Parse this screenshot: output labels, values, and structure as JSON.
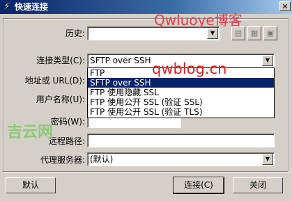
{
  "window": {
    "title": "快速连接",
    "close_glyph": "✕",
    "icon": "lightning-icon"
  },
  "form": {
    "history_label": "历史:",
    "history_value": "",
    "conn_type_label": "连接类型(C):",
    "conn_type_value": "SFTP over SSH",
    "address_label": "地址或 URL(D):",
    "username_label": "用户名称(U):",
    "password_label": "密码(W):",
    "password_value": "",
    "remote_path_label": "远程路径:",
    "remote_path_value": "",
    "proxy_label": "代理服务器:",
    "proxy_value": "(默认)"
  },
  "dropdown": {
    "options": [
      "FTP",
      "SFTP over SSH",
      "FTP 使用隐藏 SSL",
      "FTP 使用公开 SSL (验证 SSL)",
      "FTP 使用公开 SSL (验证 TLS)"
    ],
    "selected_index": 1
  },
  "toolbar": {
    "icons": [
      "history-save-icon",
      "history-edit-icon",
      "history-delete-icon"
    ],
    "glyphs": [
      "▤",
      "▦",
      "▣"
    ]
  },
  "buttons": {
    "default_label": "默认",
    "connect_label": "连接(C)",
    "close_label": "关闭"
  },
  "watermarks": {
    "blog_name": "Qwluoye博客",
    "blog_url": "qwblog.cn",
    "site_logo": "吉云网"
  },
  "colors": {
    "selection": "#0a246a",
    "titlebar": "#0a246a",
    "dialog_bg": "#d4d0c8"
  }
}
